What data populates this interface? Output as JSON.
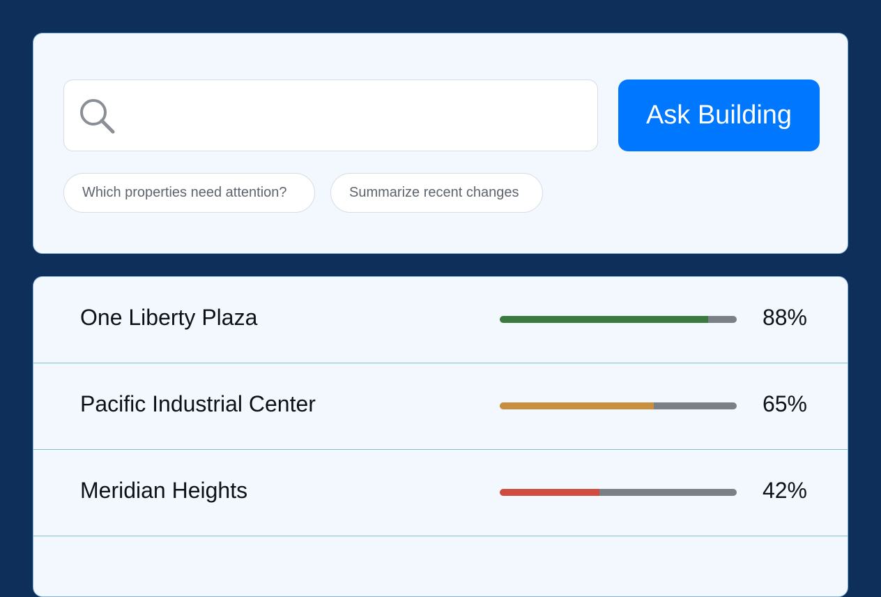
{
  "search": {
    "value": "",
    "button_label": "Ask Building",
    "icon": "search-icon",
    "suggestions": [
      "Which properties need attention?",
      "Summarize recent changes"
    ]
  },
  "properties": [
    {
      "name": "One Liberty Plaza",
      "score": 88,
      "score_label": "88%",
      "color": "#3a7a3f"
    },
    {
      "name": "Pacific Industrial Center",
      "score": 65,
      "score_label": "65%",
      "color": "#c98f3e"
    },
    {
      "name": "Meridian Heights",
      "score": 42,
      "score_label": "42%",
      "color": "#d04c3f"
    }
  ],
  "colors": {
    "background": "#0e2f5a",
    "accent": "#0077ff",
    "card": "#f3f7fe",
    "track": "#7b7f86"
  }
}
